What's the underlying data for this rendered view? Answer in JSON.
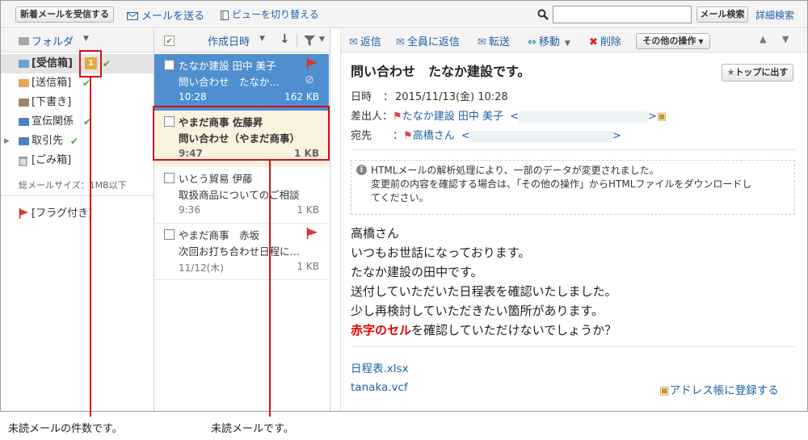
{
  "toolbar": {
    "receive_label": "新着メールを受信する",
    "compose_label": "メールを送る",
    "view_toggle_label": "ビューを切り替える",
    "search_button_label": "メール検索",
    "advanced_search_label": "詳細検索"
  },
  "folders": {
    "header_label": "フォルダ",
    "items": [
      {
        "label": "[受信箱]",
        "unread": "1"
      },
      {
        "label": "[送信箱]"
      },
      {
        "label": "[下書き]"
      },
      {
        "label": "宣伝関係"
      },
      {
        "label": "取引先"
      },
      {
        "label": "[ごみ箱]"
      }
    ],
    "size_note": "総メールサイズ：1MB以下",
    "flagged_label": "[フラグ付き]"
  },
  "list": {
    "sort_label": "作成日時",
    "items": [
      {
        "sender": "たなか建設 田中 美子",
        "subject": "問い合わせ　たなか…",
        "time": "10:28",
        "size": "162 KB"
      },
      {
        "sender": "やまだ商事 佐藤昇",
        "subject": "問い合わせ（やまだ商事）",
        "time": "9:47",
        "size": "1 KB"
      },
      {
        "sender": "いとう貿易 伊藤",
        "subject": "取扱商品についてのご相談",
        "time": "9:36",
        "size": "1 KB"
      },
      {
        "sender": "やまだ商事　赤坂",
        "subject": "次回お打ち合わせ日程に…",
        "time": "11/12(木)",
        "size": "1 KB"
      }
    ]
  },
  "message_toolbar": {
    "reply": "返信",
    "reply_all": "全員に返信",
    "forward": "転送",
    "move": "移動",
    "delete": "削除",
    "other": "その他の操作"
  },
  "message": {
    "subject": "問い合わせ　たなか建設です。",
    "pin_label": "トップに出す",
    "date_label": "日時",
    "date_value": "2015/11/13(金) 10:28",
    "from_label": "差出人",
    "from_value": "たなか建設 田中 美子",
    "to_label": "宛先",
    "to_value": "高橋さん",
    "colon": "：",
    "lt": "<",
    "gt": ">",
    "notice_line1": "HTMLメールの解析処理により、一部のデータが変更されました。",
    "notice_line2": "変更前の内容を確認する場合は、「その他の操作」からHTMLファイルをダウンロードし",
    "notice_line3": "てください。",
    "body": [
      "高橋さん",
      "いつもお世話になっております。",
      "たなか建設の田中です。",
      "送付していただいた日程表を確認いたしました。",
      "少し再検討していただきたい箇所があります。"
    ],
    "body_red": "赤字のセル",
    "body_last_rest": "を確認していただけないでしょうか？",
    "attachments": [
      "日程表.xlsx",
      "tanaka.vcf"
    ],
    "address_book_label": "アドレス帳に登録する"
  },
  "annotations": {
    "unread_count": "未読メールの件数です。",
    "unread_mail": "未読メールです。"
  },
  "colors": {
    "accent": "#1f5fa8",
    "selected": "#4f8fd0",
    "unread_bg": "#fbf1df",
    "annotation": "#d5101a",
    "flag": "#e0342f",
    "badge": "#e8a93c"
  }
}
